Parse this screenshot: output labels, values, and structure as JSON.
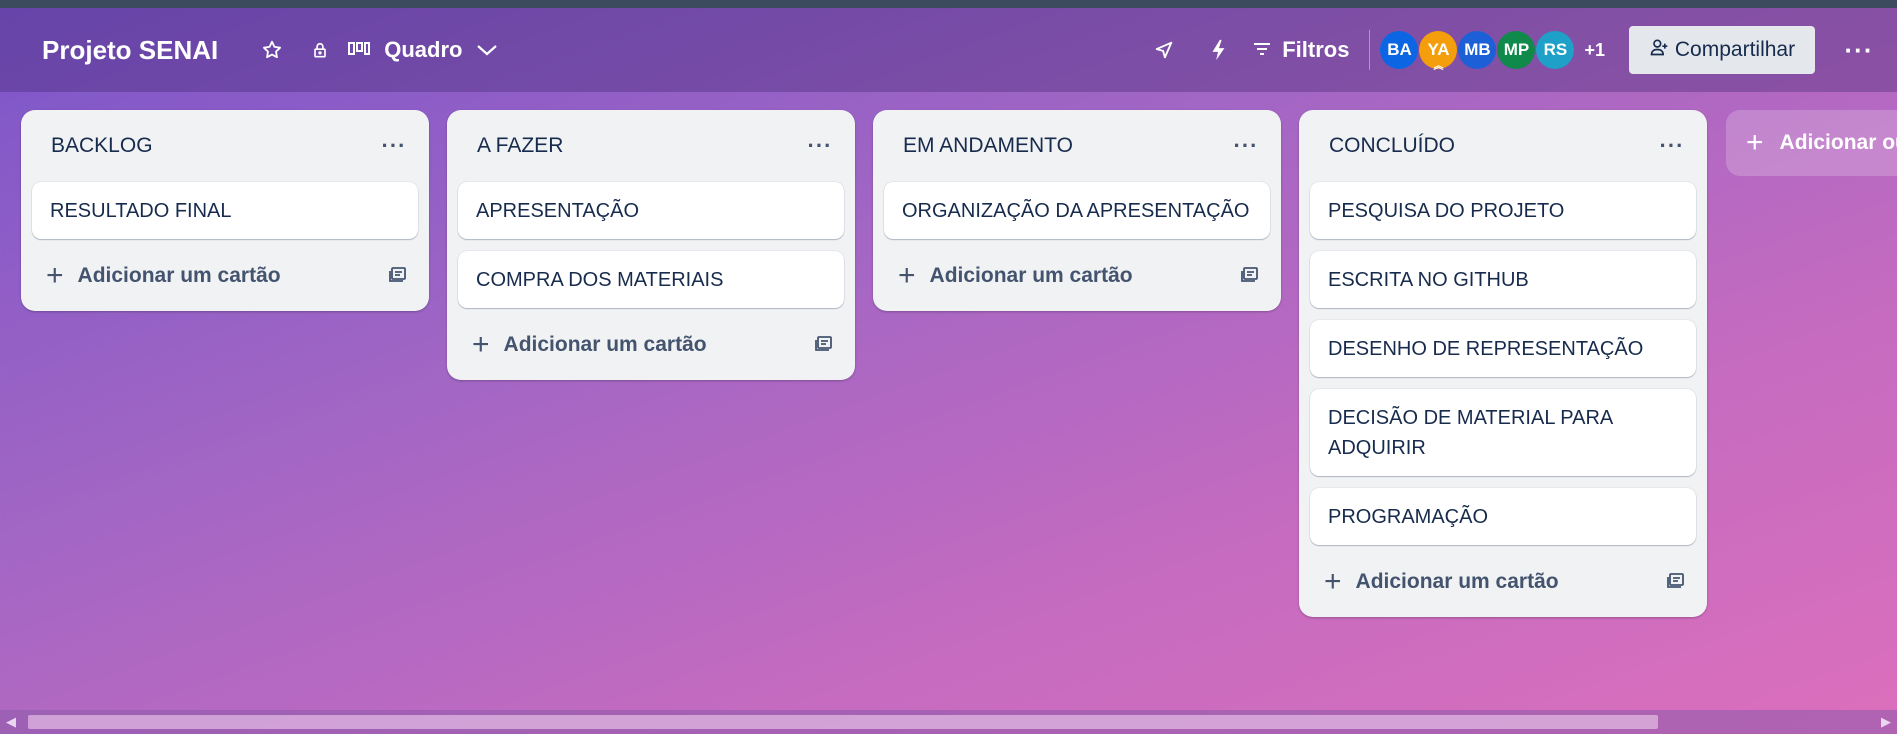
{
  "header": {
    "board_title": "Projeto SENAI",
    "view_label": "Quadro",
    "filters_label": "Filtros",
    "members": [
      {
        "initials": "BA",
        "color": "#0c66e4"
      },
      {
        "initials": "YA",
        "color": "#f59e0b"
      },
      {
        "initials": "MB",
        "color": "#1d5fd6"
      },
      {
        "initials": "MP",
        "color": "#0f8a4a"
      },
      {
        "initials": "RS",
        "color": "#1ea0c8"
      }
    ],
    "more_members": "+1",
    "share_label": "Compartilhar"
  },
  "lists": [
    {
      "title": "BACKLOG",
      "cards": [
        "RESULTADO FINAL"
      ],
      "add_label": "Adicionar um cartão"
    },
    {
      "title": "A FAZER",
      "cards": [
        "APRESENTAÇÃO",
        "COMPRA DOS MATERIAIS"
      ],
      "add_label": "Adicionar um cartão"
    },
    {
      "title": "EM ANDAMENTO",
      "cards": [
        "ORGANIZAÇÃO DA APRESENTAÇÃO"
      ],
      "add_label": "Adicionar um cartão"
    },
    {
      "title": "CONCLUÍDO",
      "cards": [
        "PESQUISA DO PROJETO",
        "ESCRITA NO GITHUB",
        "DESENHO DE REPRESENTAÇÃO",
        "DECISÃO DE MATERIAL PARA ADQUIRIR",
        "PROGRAMAÇÃO"
      ],
      "add_label": "Adicionar um cartão"
    }
  ],
  "add_list_label": "Adicionar ou",
  "icons": {
    "star": "star-icon",
    "lock": "lock-icon",
    "board": "board-view-icon",
    "chevron": "chevron-down-icon",
    "power_ups": "rocket-icon",
    "automation": "lightning-icon",
    "filter": "filter-icon",
    "share": "add-person-icon",
    "template": "card-template-icon"
  }
}
